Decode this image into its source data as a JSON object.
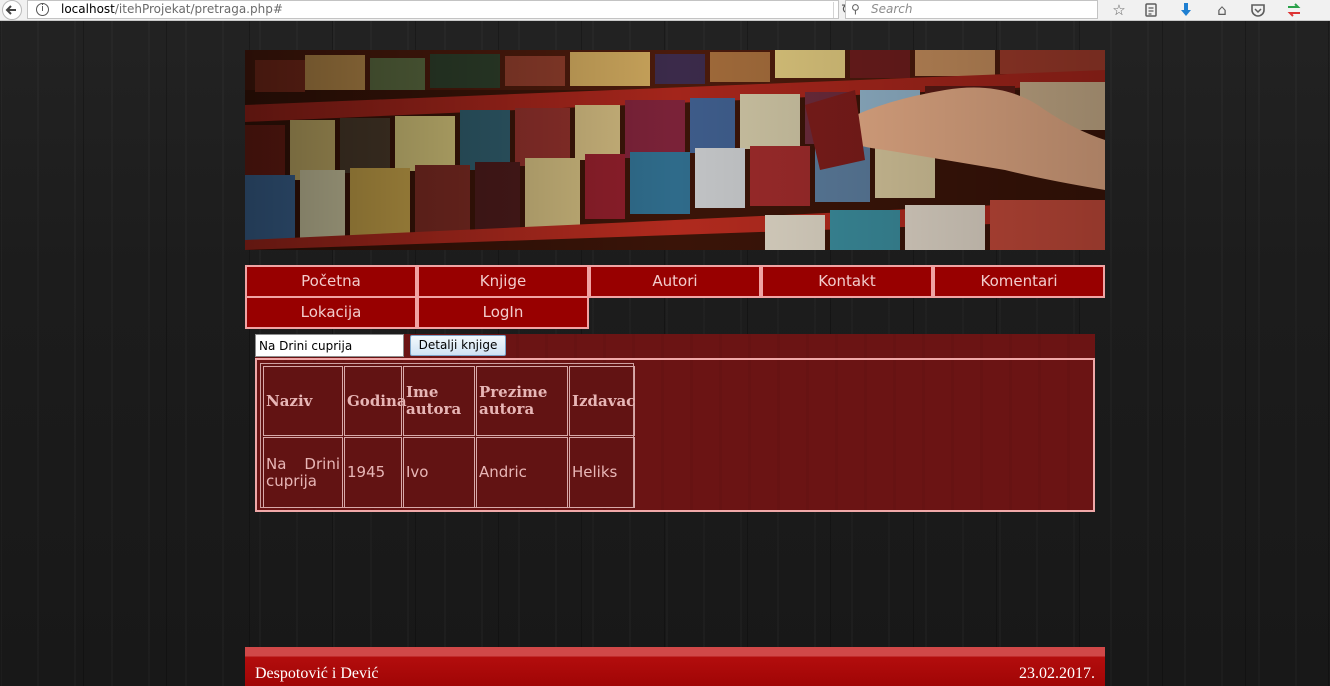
{
  "browser": {
    "url_host": "localhost",
    "url_path": "/itehProjekat/pretraga.php#",
    "search_placeholder": "Search"
  },
  "nav": {
    "items": [
      "Početna",
      "Knjige",
      "Autori",
      "Kontakt",
      "Komentari",
      "Lokacija",
      "LogIn"
    ]
  },
  "search_form": {
    "input_value": "Na Drini cuprija",
    "button_label": "Detalji knjige"
  },
  "results": {
    "headers": [
      "Naziv",
      "Godina",
      "Ime autora",
      "Prezime autora",
      "Izdavac"
    ],
    "rows": [
      [
        "Na Drini cuprija",
        "1945",
        "Ivo",
        "Andric",
        "Heliks"
      ]
    ]
  },
  "footer": {
    "authors": "Despotović i Dević",
    "date": "23.02.2017."
  }
}
